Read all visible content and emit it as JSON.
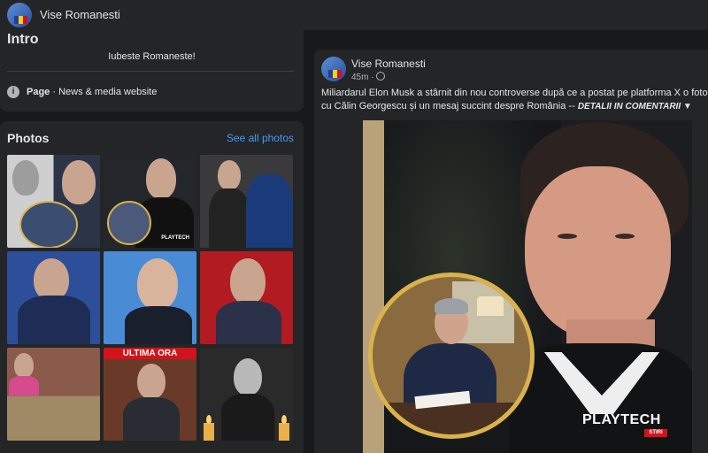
{
  "header": {
    "title": "Vise Romanesti"
  },
  "intro": {
    "heading": "Intro",
    "bio": "Iubeste Romaneste!",
    "page_label": "Page",
    "page_category": "· News & media website"
  },
  "photos": {
    "heading": "Photos",
    "see_all": "See all photos",
    "items": [
      {
        "name": "photo-elon-musk-portrait"
      },
      {
        "name": "photo-elon-musk-office"
      },
      {
        "name": "photo-police-crowd"
      },
      {
        "name": "photo-politician-microphone"
      },
      {
        "name": "photo-politician-speaking"
      },
      {
        "name": "photo-politician-red-background"
      },
      {
        "name": "photo-constitutional-court"
      },
      {
        "name": "photo-ultima-ora"
      },
      {
        "name": "photo-memorial-candles"
      }
    ],
    "banner": "ULTIMA ORA",
    "logo": "PLAYTECH"
  },
  "post": {
    "author": "Vise Romanesti",
    "time": "45m ·",
    "text_line1": "Miliardarul Elon Musk a stârnit din nou controverse după ce a postat pe platforma X o fotog",
    "text_line2": "cu Călin Georgescu și un mesaj succint despre România --",
    "text_detail": "DETALII IN COMENTARII ▼",
    "image_logo": "PLAYTECH",
    "image_logo_sub": "STIRI"
  },
  "colors": {
    "background": "#18191a",
    "card": "#242526",
    "link": "#4599ff",
    "accent_gold": "#d9b24c",
    "accent_red": "#d4121b"
  }
}
